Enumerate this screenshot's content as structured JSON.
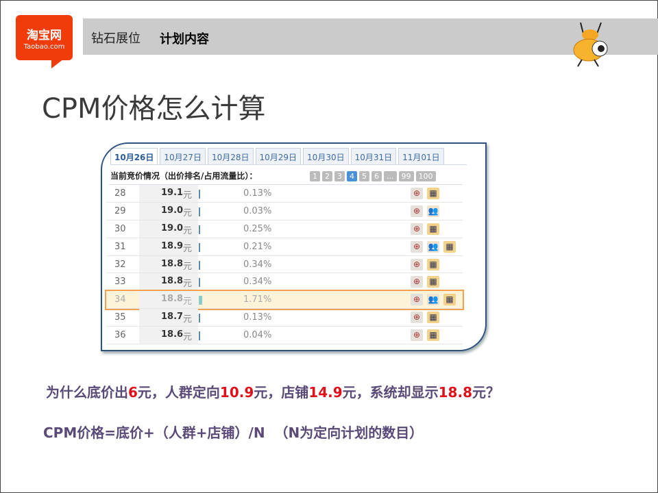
{
  "logo": {
    "cn": "淘宝网",
    "en": "Taobao.com"
  },
  "header": {
    "section": "钻石展位",
    "current": "计划内容"
  },
  "title": "CPM价格怎么计算",
  "panel": {
    "tabs": [
      "10月26日",
      "10月27日",
      "10月28日",
      "10月29日",
      "10月30日",
      "10月31日",
      "11月01日"
    ],
    "active_tab": 0,
    "heading": "当前竞价情况（出价排名/占用流量比）：",
    "pages": [
      "1",
      "2",
      "3",
      "4",
      "5",
      "6",
      "...",
      "99",
      "100"
    ],
    "current_page": "4",
    "unit": "元",
    "rows": [
      {
        "rank": "28",
        "price": "19.1",
        "pct": "0.13%",
        "icons": [
          "all",
          "shop"
        ]
      },
      {
        "rank": "29",
        "price": "19.0",
        "pct": "0.03%",
        "icons": [
          "all",
          "people"
        ]
      },
      {
        "rank": "30",
        "price": "19.0",
        "pct": "0.25%",
        "icons": [
          "all",
          "shop"
        ]
      },
      {
        "rank": "31",
        "price": "18.9",
        "pct": "0.21%",
        "icons": [
          "all",
          "people",
          "shop"
        ]
      },
      {
        "rank": "32",
        "price": "18.8",
        "pct": "0.34%",
        "icons": [
          "all",
          "shop"
        ]
      },
      {
        "rank": "33",
        "price": "18.8",
        "pct": "0.34%",
        "icons": [
          "all",
          "shop"
        ]
      },
      {
        "rank": "34",
        "price": "18.8",
        "pct": "1.71%",
        "icons": [
          "all",
          "people",
          "shop"
        ],
        "highlighted": true
      },
      {
        "rank": "35",
        "price": "18.7",
        "pct": "0.13%",
        "icons": [
          "all",
          "shop"
        ]
      },
      {
        "rank": "36",
        "price": "18.6",
        "pct": "0.04%",
        "icons": [
          "all",
          "shop"
        ]
      }
    ]
  },
  "question": {
    "p1": "为什么底价出",
    "v1": "6",
    "p2": "元，人群定向",
    "v2": "10.9",
    "p3": "元，店铺",
    "v3": "14.9",
    "p4": "元，系统却显示",
    "v4": "18.8",
    "p5": "元？"
  },
  "formula": "CPM价格=底价+（人群+店铺）/N  （N为定向计划的数目）",
  "colors": {
    "text": "#594a78",
    "highlight": "#e0101a",
    "brand": "#f03c0a"
  }
}
